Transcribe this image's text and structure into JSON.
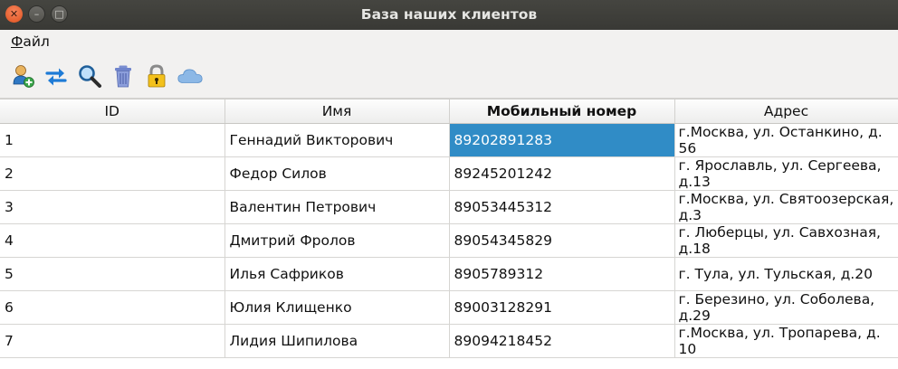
{
  "window": {
    "title": "База наших клиентов"
  },
  "menu": {
    "file_first": "Ф",
    "file_rest": "айл"
  },
  "toolbar": {
    "icons": [
      "add-user-icon",
      "refresh-icon",
      "search-icon",
      "trash-icon",
      "lock-icon",
      "cloud-icon"
    ]
  },
  "table": {
    "headers": [
      "ID",
      "Имя",
      "Мобильный номер",
      "Адрес"
    ],
    "rows": [
      {
        "id": "1",
        "name": "Геннадий Викторович",
        "phone": "89202891283",
        "address": "г.Москва, ул. Останкино, д. 56"
      },
      {
        "id": "2",
        "name": "Федор Силов",
        "phone": "89245201242",
        "address": "г. Ярославль, ул. Сергеева, д.13"
      },
      {
        "id": "3",
        "name": "Валентин Петрович",
        "phone": "89053445312",
        "address": "г.Москва, ул. Святоозерская, д.3"
      },
      {
        "id": "4",
        "name": "Дмитрий Фролов",
        "phone": "89054345829",
        "address": "г. Люберцы, ул. Савхозная, д.18"
      },
      {
        "id": "5",
        "name": "Илья Сафриков",
        "phone": "8905789312",
        "address": "г. Тула, ул. Тульская, д.20"
      },
      {
        "id": "6",
        "name": "Юлия Клищенко",
        "phone": "89003128291",
        "address": "г. Березино, ул. Соболева, д.29"
      },
      {
        "id": "7",
        "name": "Лидия Шипилова",
        "phone": "89094218452",
        "address": "г.Москва, ул. Тропарева, д. 10"
      }
    ]
  },
  "colors": {
    "selection": "#308cc6",
    "titlebar": "#3c3b37",
    "close": "#e9592a"
  }
}
